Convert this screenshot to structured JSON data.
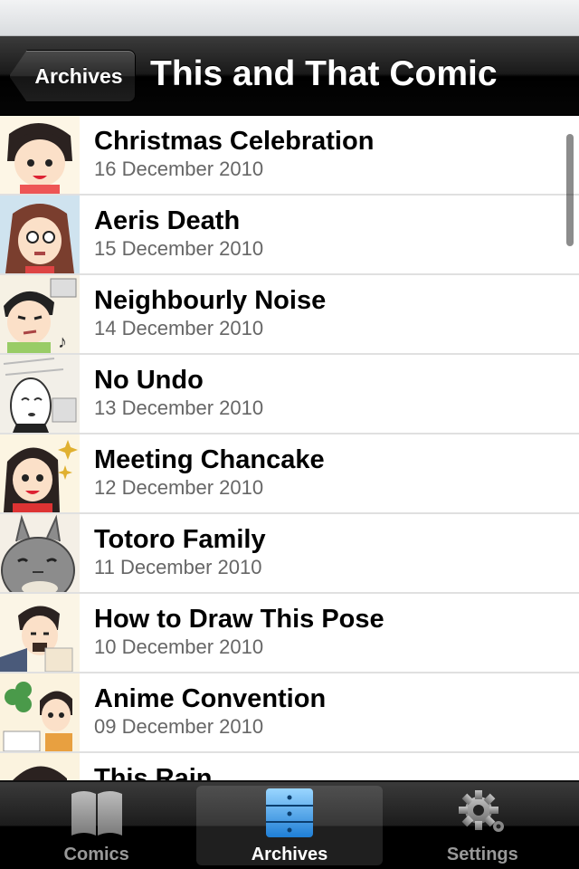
{
  "nav": {
    "back_label": "Archives",
    "title": "This and That Comic"
  },
  "comics": [
    {
      "title": "Christmas Celebration",
      "date": "16 December 2010"
    },
    {
      "title": "Aeris Death",
      "date": "15 December 2010"
    },
    {
      "title": "Neighbourly Noise",
      "date": "14 December 2010"
    },
    {
      "title": "No Undo",
      "date": "13 December 2010"
    },
    {
      "title": "Meeting Chancake",
      "date": "12 December 2010"
    },
    {
      "title": "Totoro Family",
      "date": "11 December 2010"
    },
    {
      "title": "How to Draw This Pose",
      "date": "10 December 2010"
    },
    {
      "title": "Anime Convention",
      "date": "09 December 2010"
    },
    {
      "title": "This Rain",
      "date": ""
    }
  ],
  "tabs": [
    {
      "label": "Comics",
      "icon": "book-icon",
      "selected": false
    },
    {
      "label": "Archives",
      "icon": "archive-drawer-icon",
      "selected": true
    },
    {
      "label": "Settings",
      "icon": "gear-icon",
      "selected": false
    }
  ],
  "colors": {
    "selected_tab_icon": "#3a9be8",
    "date_text": "#666666"
  }
}
